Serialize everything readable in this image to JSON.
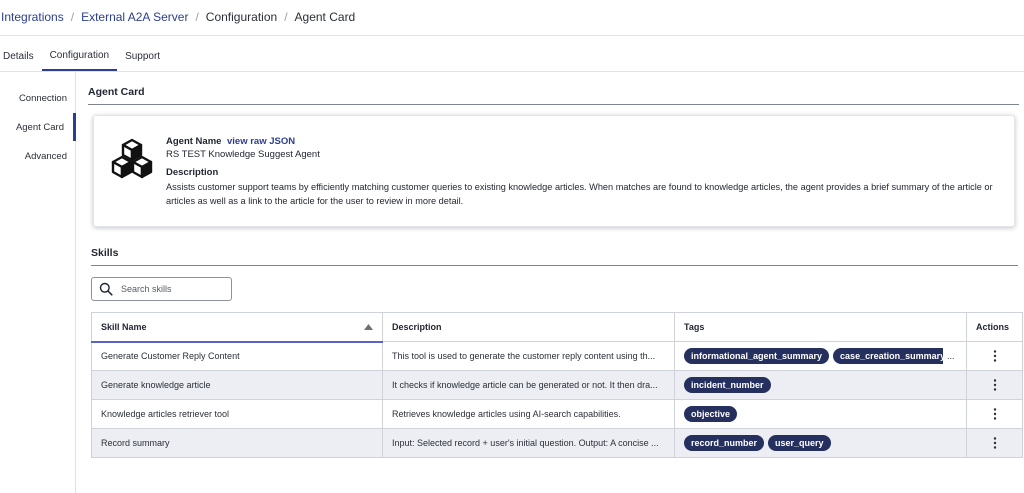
{
  "breadcrumb": {
    "items": [
      {
        "label": "Integrations"
      },
      {
        "label": "External A2A Server"
      },
      {
        "label": "Configuration"
      },
      {
        "label": "Agent Card"
      }
    ],
    "separator": "/"
  },
  "tabs": [
    {
      "label": "Details"
    },
    {
      "label": "Configuration",
      "active": true
    },
    {
      "label": "Support"
    }
  ],
  "sidenav": [
    {
      "label": "Connection"
    },
    {
      "label": "Agent Card",
      "active": true
    },
    {
      "label": "Advanced"
    }
  ],
  "agent_card": {
    "section_title": "Agent Card",
    "icon": "cubes-icon",
    "name_label": "Agent Name",
    "raw_json_link": "view raw JSON",
    "agent_name": "RS TEST Knowledge Suggest Agent",
    "description_label": "Description",
    "description": "Assists customer support teams by efficiently matching customer queries to existing knowledge articles. When matches are found to knowledge articles, the agent provides a brief summary of the article or articles as well as a link to the article for the user to review in more detail."
  },
  "skills": {
    "section_title": "Skills",
    "search": {
      "placeholder": "Search skills",
      "value": ""
    },
    "columns": [
      "Skill Name",
      "Description",
      "Tags",
      "Actions"
    ],
    "rows": [
      {
        "name": "Generate Customer Reply Content",
        "description": "This tool is used to generate the customer reply content using th...",
        "tags": [
          "informational_agent_summary",
          "case_creation_summary"
        ],
        "overflow": "..."
      },
      {
        "name": "Generate knowledge article",
        "description": "It checks if knowledge article can be generated or not. It then dra...",
        "tags": [
          "incident_number"
        ]
      },
      {
        "name": "Knowledge articles retriever tool",
        "description": "Retrieves knowledge articles using AI-search capabilities.",
        "tags": [
          "objective"
        ]
      },
      {
        "name": "Record summary",
        "description": "Input: Selected record + user's initial question. Output: A concise ...",
        "tags": [
          "record_number",
          "user_query"
        ]
      }
    ]
  },
  "colors": {
    "accent": "#2c3e8f",
    "tag_bg": "#25305e",
    "row_alt": "#eceef4"
  }
}
